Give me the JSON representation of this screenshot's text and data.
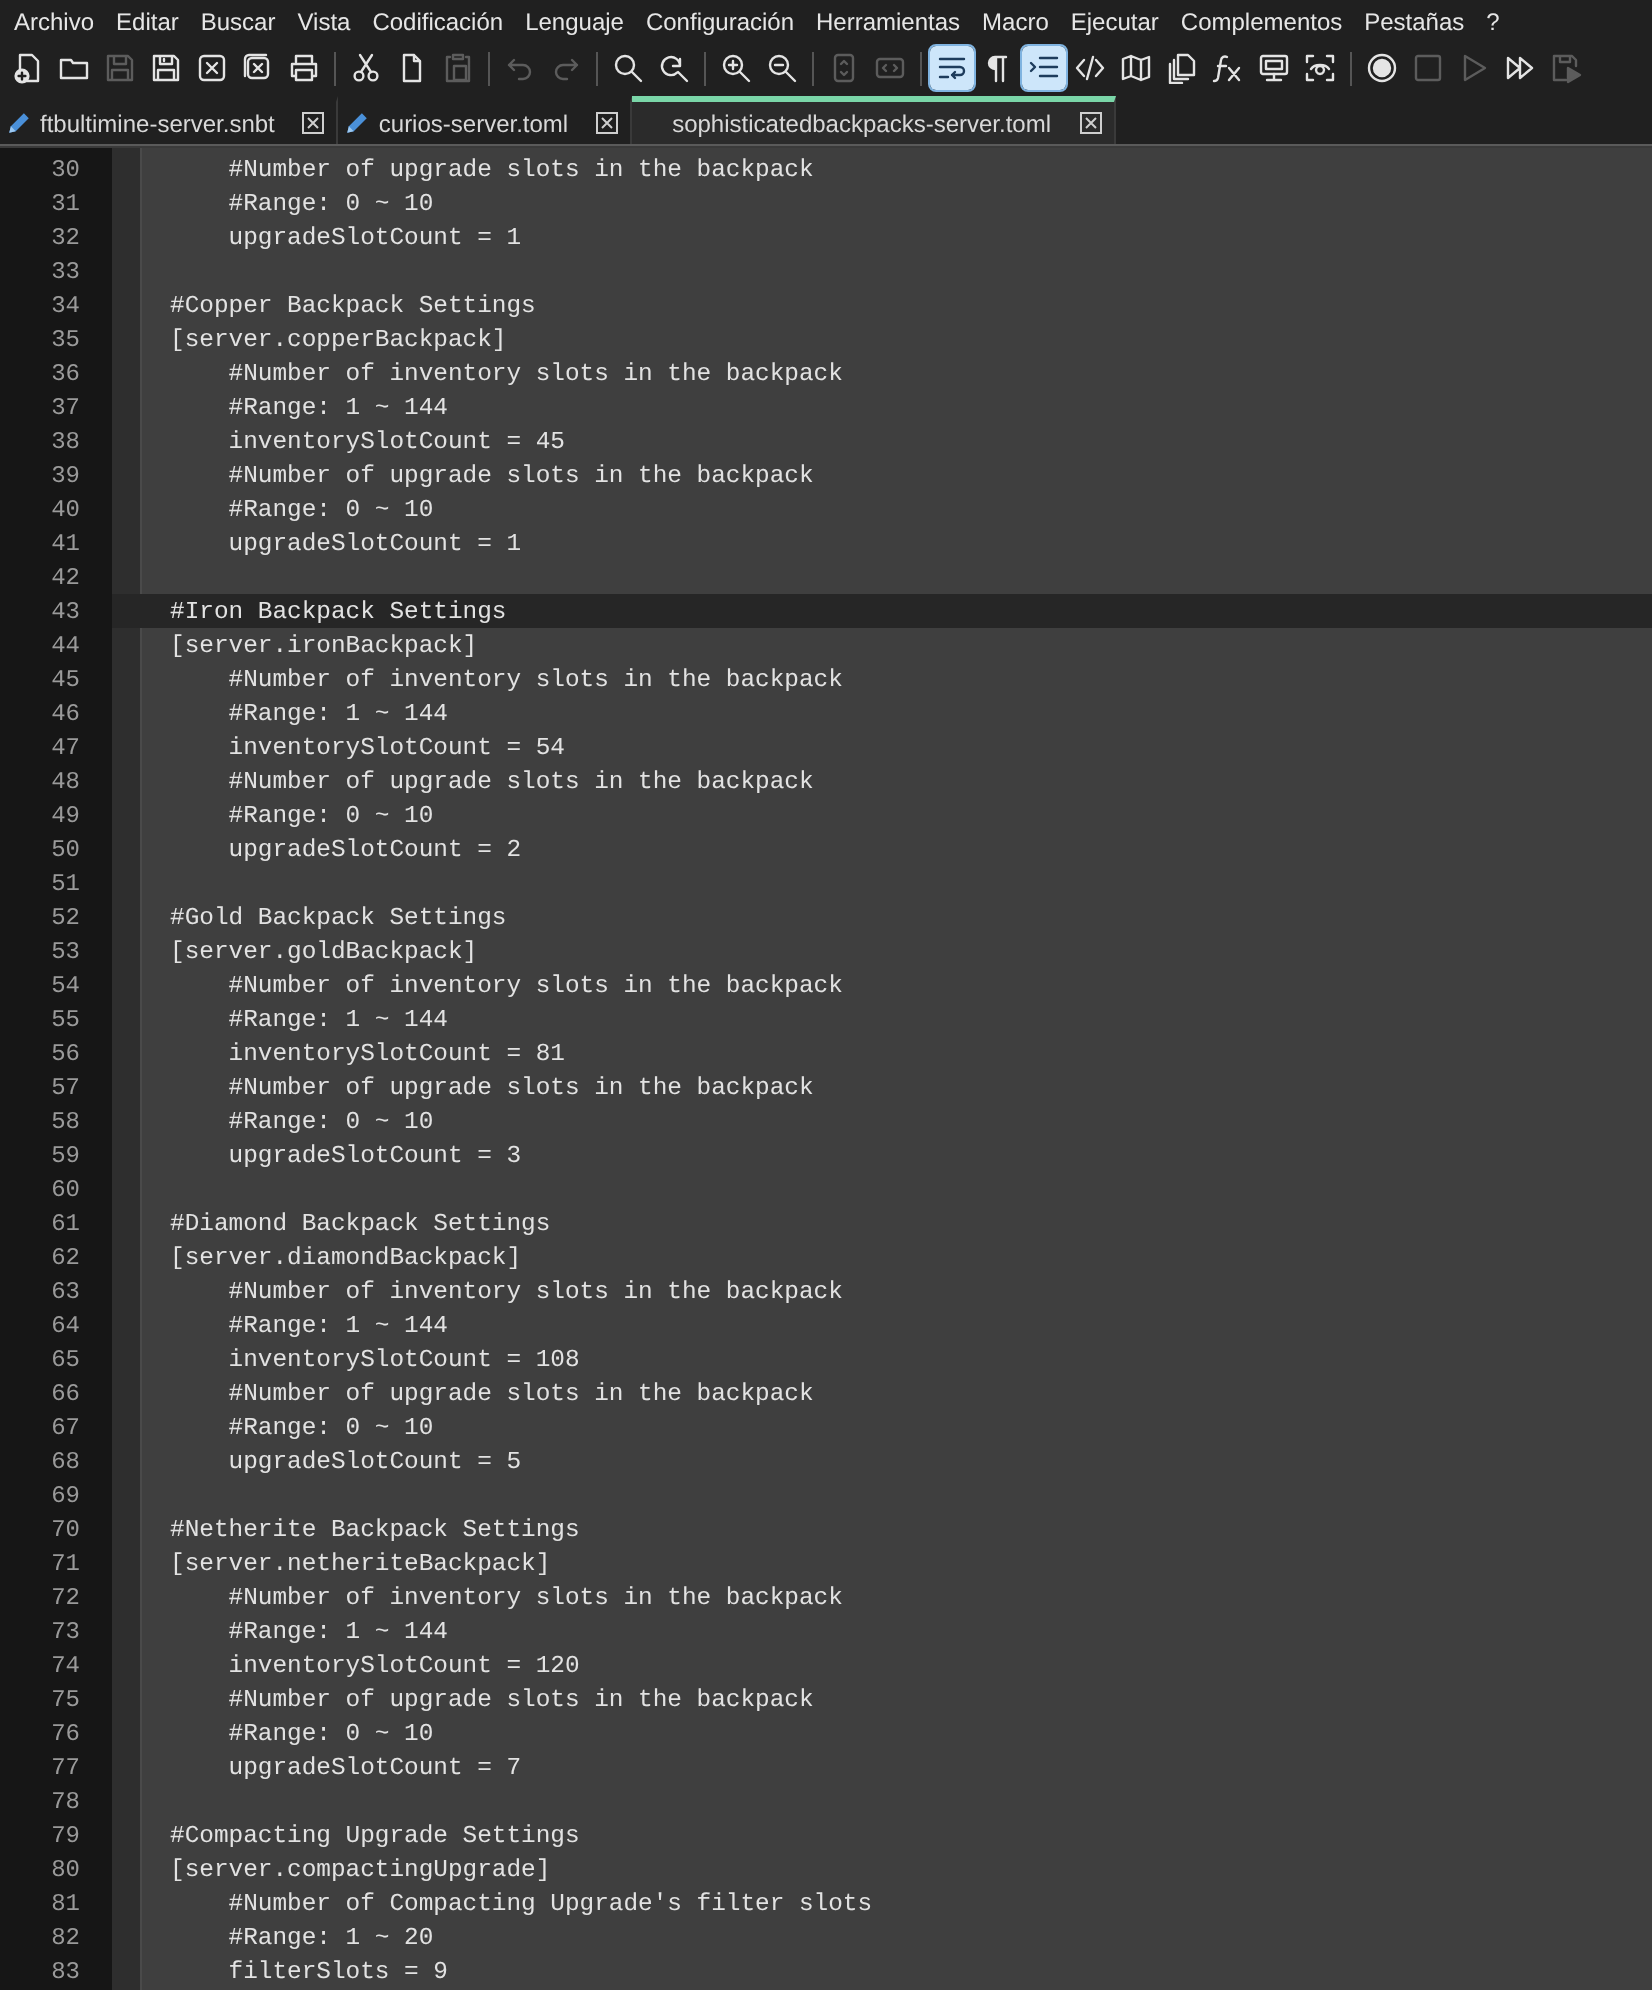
{
  "menu": [
    "Archivo",
    "Editar",
    "Buscar",
    "Vista",
    "Codificación",
    "Lenguaje",
    "Configuración",
    "Herramientas",
    "Macro",
    "Ejecutar",
    "Complementos",
    "Pestañas",
    "?"
  ],
  "toolbar": [
    [
      {
        "kind": "new",
        "disabled": false,
        "on": false
      },
      {
        "kind": "open",
        "disabled": false,
        "on": false
      },
      {
        "kind": "save",
        "disabled": true,
        "on": false
      },
      {
        "kind": "save-all",
        "disabled": false,
        "on": false
      },
      {
        "kind": "close",
        "disabled": false,
        "on": false
      },
      {
        "kind": "close-all",
        "disabled": false,
        "on": false
      },
      {
        "kind": "print",
        "disabled": false,
        "on": false
      }
    ],
    [
      {
        "kind": "cut",
        "disabled": false,
        "on": false
      },
      {
        "kind": "copy",
        "disabled": false,
        "on": false
      },
      {
        "kind": "paste",
        "disabled": true,
        "on": false
      }
    ],
    [
      {
        "kind": "undo",
        "disabled": true,
        "on": false
      },
      {
        "kind": "redo",
        "disabled": true,
        "on": false
      }
    ],
    [
      {
        "kind": "find",
        "disabled": false,
        "on": false
      },
      {
        "kind": "replace",
        "disabled": false,
        "on": false
      }
    ],
    [
      {
        "kind": "zoom-in",
        "disabled": false,
        "on": false
      },
      {
        "kind": "zoom-out",
        "disabled": false,
        "on": false
      }
    ],
    [
      {
        "kind": "sync-v",
        "disabled": true,
        "on": false
      },
      {
        "kind": "sync-h",
        "disabled": true,
        "on": false
      }
    ],
    [
      {
        "kind": "wrap",
        "disabled": false,
        "on": true
      },
      {
        "kind": "all-chars",
        "disabled": false,
        "on": false
      },
      {
        "kind": "indent-guide",
        "disabled": false,
        "on": true
      },
      {
        "kind": "xml",
        "disabled": false,
        "on": false
      },
      {
        "kind": "doc-map",
        "disabled": false,
        "on": false
      },
      {
        "kind": "doc-list",
        "disabled": false,
        "on": false
      },
      {
        "kind": "function-list",
        "disabled": false,
        "on": false
      },
      {
        "kind": "monitor",
        "disabled": false,
        "on": false
      },
      {
        "kind": "workspace",
        "disabled": false,
        "on": false
      }
    ],
    [
      {
        "kind": "record",
        "disabled": false,
        "on": false
      },
      {
        "kind": "stop",
        "disabled": true,
        "on": false
      },
      {
        "kind": "play",
        "disabled": true,
        "on": false
      },
      {
        "kind": "play-multiple",
        "disabled": false,
        "on": false
      },
      {
        "kind": "save-macro",
        "disabled": true,
        "on": false
      }
    ]
  ],
  "tabs": [
    {
      "label": "ftbultimine-server.snbt",
      "selected": false,
      "modified": true
    },
    {
      "label": "curios-server.toml",
      "selected": false,
      "modified": true
    },
    {
      "label": "sophisticatedbackpacks-server.toml",
      "selected": true,
      "modified": false
    }
  ],
  "lines": [
    {
      "number": "30",
      "text": "    #Number of upgrade slots in the backpack",
      "current": false
    },
    {
      "number": "31",
      "text": "    #Range: 0 ~ 10",
      "current": false
    },
    {
      "number": "32",
      "text": "    upgradeSlotCount = 1",
      "current": false
    },
    {
      "number": "33",
      "current": false
    },
    {
      "number": "34",
      "text": "#Copper Backpack Settings",
      "current": false
    },
    {
      "number": "35",
      "text": "[server.copperBackpack]",
      "current": false
    },
    {
      "number": "36",
      "text": "    #Number of inventory slots in the backpack",
      "current": false
    },
    {
      "number": "37",
      "text": "    #Range: 1 ~ 144",
      "current": false
    },
    {
      "number": "38",
      "text": "    inventorySlotCount = 45",
      "current": false
    },
    {
      "number": "39",
      "text": "    #Number of upgrade slots in the backpack",
      "current": false
    },
    {
      "number": "40",
      "text": "    #Range: 0 ~ 10",
      "current": false
    },
    {
      "number": "41",
      "text": "    upgradeSlotCount = 1",
      "current": false
    },
    {
      "number": "42",
      "current": false
    },
    {
      "number": "43",
      "text": "#Iron Backpack Settings",
      "current": true
    },
    {
      "number": "44",
      "text": "[server.ironBackpack]",
      "current": false
    },
    {
      "number": "45",
      "text": "    #Number of inventory slots in the backpack",
      "current": false
    },
    {
      "number": "46",
      "text": "    #Range: 1 ~ 144",
      "current": false
    },
    {
      "number": "47",
      "text": "    inventorySlotCount = 54",
      "current": false
    },
    {
      "number": "48",
      "text": "    #Number of upgrade slots in the backpack",
      "current": false
    },
    {
      "number": "49",
      "text": "    #Range: 0 ~ 10",
      "current": false
    },
    {
      "number": "50",
      "text": "    upgradeSlotCount = 2",
      "current": false
    },
    {
      "number": "51",
      "current": false
    },
    {
      "number": "52",
      "text": "#Gold Backpack Settings",
      "current": false
    },
    {
      "number": "53",
      "text": "[server.goldBackpack]",
      "current": false
    },
    {
      "number": "54",
      "text": "    #Number of inventory slots in the backpack",
      "current": false
    },
    {
      "number": "55",
      "text": "    #Range: 1 ~ 144",
      "current": false
    },
    {
      "number": "56",
      "text": "    inventorySlotCount = 81",
      "current": false
    },
    {
      "number": "57",
      "text": "    #Number of upgrade slots in the backpack",
      "current": false
    },
    {
      "number": "58",
      "text": "    #Range: 0 ~ 10",
      "current": false
    },
    {
      "number": "59",
      "text": "    upgradeSlotCount = 3",
      "current": false
    },
    {
      "number": "60",
      "current": false
    },
    {
      "number": "61",
      "text": "#Diamond Backpack Settings",
      "current": false
    },
    {
      "number": "62",
      "text": "[server.diamondBackpack]",
      "current": false
    },
    {
      "number": "63",
      "text": "    #Number of inventory slots in the backpack",
      "current": false
    },
    {
      "number": "64",
      "text": "    #Range: 1 ~ 144",
      "current": false
    },
    {
      "number": "65",
      "text": "    inventorySlotCount = 108",
      "current": false
    },
    {
      "number": "66",
      "text": "    #Number of upgrade slots in the backpack",
      "current": false
    },
    {
      "number": "67",
      "text": "    #Range: 0 ~ 10",
      "current": false
    },
    {
      "number": "68",
      "text": "    upgradeSlotCount = 5",
      "current": false
    },
    {
      "number": "69",
      "current": false
    },
    {
      "number": "70",
      "text": "#Netherite Backpack Settings",
      "current": false
    },
    {
      "number": "71",
      "text": "[server.netheriteBackpack]",
      "current": false
    },
    {
      "number": "72",
      "text": "    #Number of inventory slots in the backpack",
      "current": false
    },
    {
      "number": "73",
      "text": "    #Range: 1 ~ 144",
      "current": false
    },
    {
      "number": "74",
      "text": "    inventorySlotCount = 120",
      "current": false
    },
    {
      "number": "75",
      "text": "    #Number of upgrade slots in the backpack",
      "current": false
    },
    {
      "number": "76",
      "text": "    #Range: 0 ~ 10",
      "current": false
    },
    {
      "number": "77",
      "text": "    upgradeSlotCount = 7",
      "current": false
    },
    {
      "number": "78",
      "current": false
    },
    {
      "number": "79",
      "text": "#Compacting Upgrade Settings",
      "current": false
    },
    {
      "number": "80",
      "text": "[server.compactingUpgrade]",
      "current": false
    },
    {
      "number": "81",
      "text": "    #Number of Compacting Upgrade's filter slots",
      "current": false
    },
    {
      "number": "82",
      "text": "    #Range: 1 ~ 20",
      "current": false
    },
    {
      "number": "83",
      "text": "    filterSlots = 9",
      "current": false
    }
  ]
}
